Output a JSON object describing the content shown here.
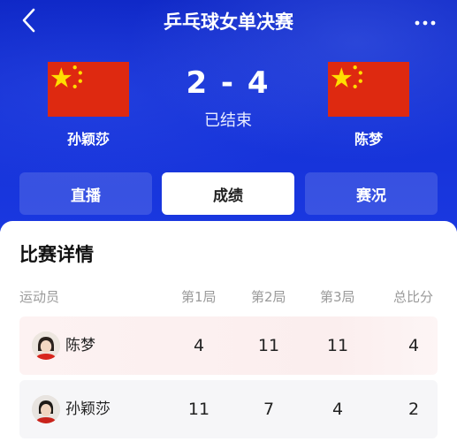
{
  "header": {
    "title": "乒乓球女单决赛",
    "back_icon": "chevron-left-icon",
    "more_icon": "more-horizontal-icon"
  },
  "match": {
    "left_player": "孙颖莎",
    "right_player": "陈梦",
    "score": "2 - 4",
    "status": "已结束",
    "flag_icon": "china-flag-icon"
  },
  "tabs": [
    {
      "label": "直播",
      "active": false
    },
    {
      "label": "成绩",
      "active": true
    },
    {
      "label": "赛况",
      "active": false
    }
  ],
  "details": {
    "title": "比赛详情",
    "columns": [
      "运动员",
      "第1局",
      "第2局",
      "第3局",
      "总比分"
    ],
    "rows": [
      {
        "name": "陈梦",
        "g1": "4",
        "g2": "11",
        "g3": "11",
        "total": "4"
      },
      {
        "name": "孙颖莎",
        "g1": "11",
        "g2": "7",
        "g3": "4",
        "total": "2"
      }
    ]
  },
  "colors": {
    "header_blue": "#1532d8",
    "flag_red": "#de2910",
    "flag_star": "#ffde00"
  }
}
